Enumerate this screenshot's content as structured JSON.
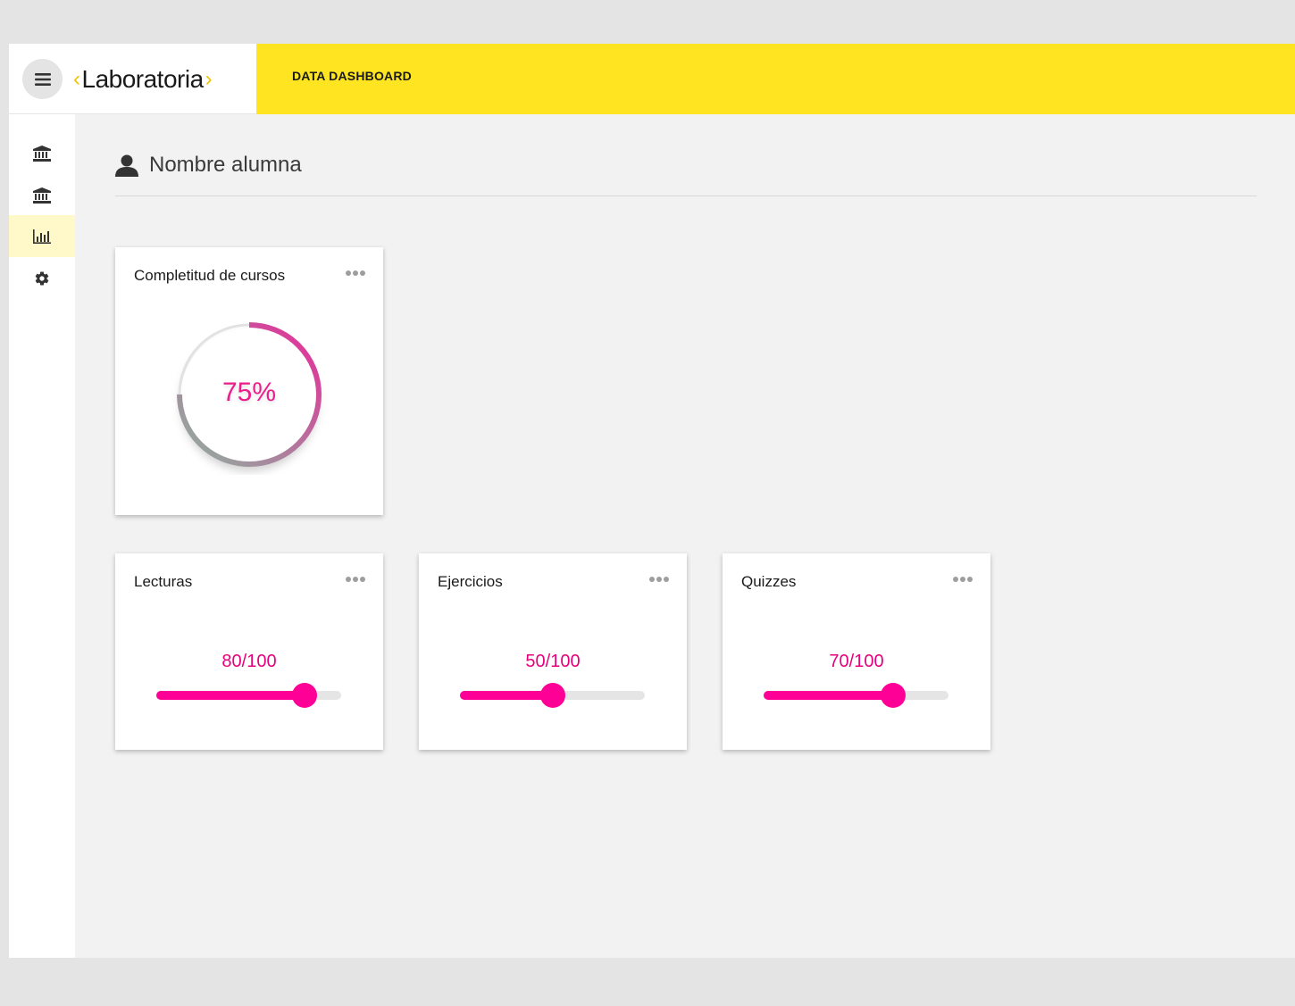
{
  "header": {
    "logo_text": "Laboratoria",
    "title": "DATA DASHBOARD"
  },
  "sidebar": {
    "items": [
      {
        "icon": "bank-icon",
        "active": false
      },
      {
        "icon": "bank-icon",
        "active": false
      },
      {
        "icon": "bar-chart-icon",
        "active": true
      },
      {
        "icon": "gear-icon",
        "active": false
      }
    ]
  },
  "colors": {
    "accent_yellow": "#ffe521",
    "accent_pink": "#ff0097",
    "active_item_bg": "#fff9c9"
  },
  "page": {
    "title": "Nombre alumna"
  },
  "completion": {
    "title": "Completitud de cursos",
    "percent_label": "75%",
    "percent": 75
  },
  "metrics": [
    {
      "title": "Lecturas",
      "score_label": "80/100",
      "value": 80,
      "max": 100
    },
    {
      "title": "Ejercicios",
      "score_label": "50/100",
      "value": 50,
      "max": 100
    },
    {
      "title": "Quizzes",
      "score_label": "70/100",
      "value": 70,
      "max": 100
    }
  ]
}
